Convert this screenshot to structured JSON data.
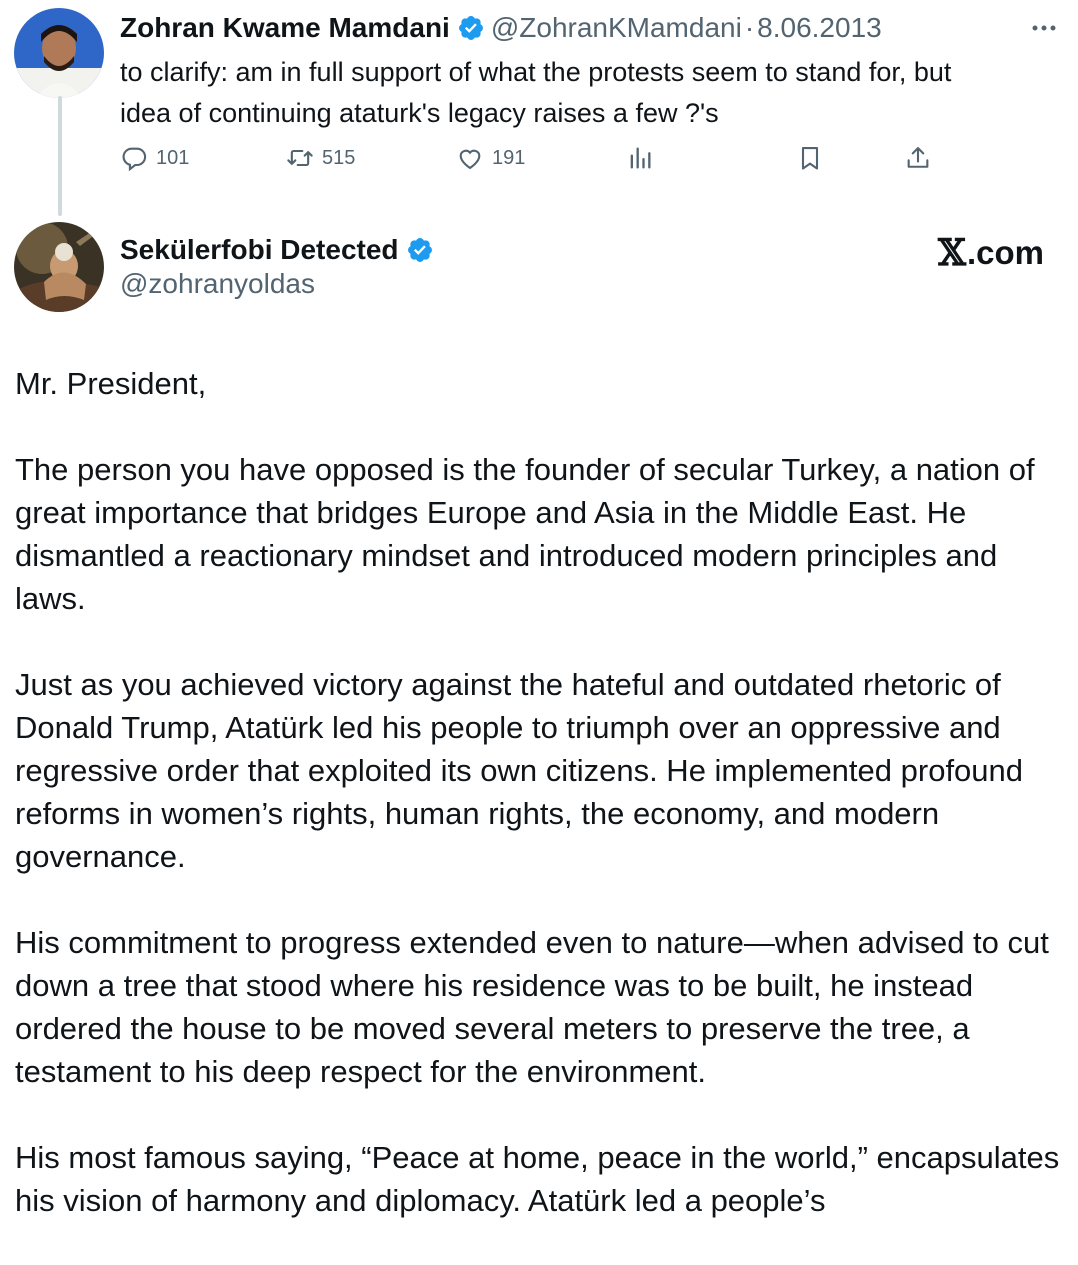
{
  "tweet1": {
    "author_name": "Zohran Kwame Mamdani",
    "handle": "@ZohranKMamdani",
    "separator": "·",
    "date": "8.06.2013",
    "text_line1": "to clarify: am in full support of what the protests seem to stand for, but",
    "text_line2": "idea of continuing ataturk's legacy raises a few ?'s",
    "replies": "101",
    "retweets": "515",
    "likes": "191"
  },
  "tweet2": {
    "author_name": "Sekülerfobi Detected",
    "handle": "@zohranyoldas",
    "brand_x": "𝕏",
    "brand_domain": ".com",
    "paragraphs": [
      "Mr. President,",
      "The person you have opposed is the founder of secular Turkey, a nation of great importance that bridges Europe and Asia in the Middle East. He dismantled a reactionary mindset and introduced modern principles and laws.",
      "Just as you achieved victory against the hateful and outdated rhetoric of Donald Trump, Atatürk led his people to triumph over an oppressive and regressive order that exploited its own citizens. He implemented profound reforms in women’s rights, human rights, the economy, and modern governance.",
      "His commitment to progress extended even to nature—when advised to cut down a tree that stood where his residence was to be built, he instead ordered the house to be moved several meters to preserve the tree, a testament to his deep respect for the environment.",
      "His most famous saying, “Peace at home, peace in the world,” encapsulates his vision of harmony and diplomacy. Atatürk led a people’s"
    ]
  },
  "colors": {
    "text": "#0f1419",
    "secondary": "#536471",
    "verified_blue": "#1d9bf0",
    "thread_line": "#cfd9de"
  },
  "icons": [
    "verified-badge-icon",
    "more-icon",
    "reply-icon",
    "retweet-icon",
    "like-icon",
    "views-icon",
    "bookmark-icon",
    "share-icon"
  ]
}
